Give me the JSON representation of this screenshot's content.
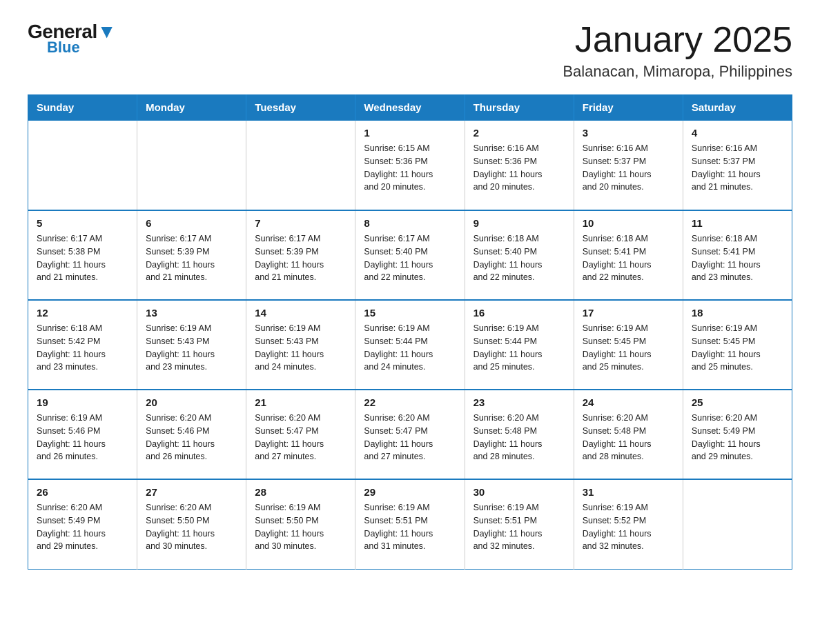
{
  "header": {
    "logo_general": "General",
    "logo_blue": "Blue",
    "month_title": "January 2025",
    "location": "Balanacan, Mimaropa, Philippines"
  },
  "calendar": {
    "days_of_week": [
      "Sunday",
      "Monday",
      "Tuesday",
      "Wednesday",
      "Thursday",
      "Friday",
      "Saturday"
    ],
    "weeks": [
      [
        {
          "day": "",
          "info": ""
        },
        {
          "day": "",
          "info": ""
        },
        {
          "day": "",
          "info": ""
        },
        {
          "day": "1",
          "info": "Sunrise: 6:15 AM\nSunset: 5:36 PM\nDaylight: 11 hours\nand 20 minutes."
        },
        {
          "day": "2",
          "info": "Sunrise: 6:16 AM\nSunset: 5:36 PM\nDaylight: 11 hours\nand 20 minutes."
        },
        {
          "day": "3",
          "info": "Sunrise: 6:16 AM\nSunset: 5:37 PM\nDaylight: 11 hours\nand 20 minutes."
        },
        {
          "day": "4",
          "info": "Sunrise: 6:16 AM\nSunset: 5:37 PM\nDaylight: 11 hours\nand 21 minutes."
        }
      ],
      [
        {
          "day": "5",
          "info": "Sunrise: 6:17 AM\nSunset: 5:38 PM\nDaylight: 11 hours\nand 21 minutes."
        },
        {
          "day": "6",
          "info": "Sunrise: 6:17 AM\nSunset: 5:39 PM\nDaylight: 11 hours\nand 21 minutes."
        },
        {
          "day": "7",
          "info": "Sunrise: 6:17 AM\nSunset: 5:39 PM\nDaylight: 11 hours\nand 21 minutes."
        },
        {
          "day": "8",
          "info": "Sunrise: 6:17 AM\nSunset: 5:40 PM\nDaylight: 11 hours\nand 22 minutes."
        },
        {
          "day": "9",
          "info": "Sunrise: 6:18 AM\nSunset: 5:40 PM\nDaylight: 11 hours\nand 22 minutes."
        },
        {
          "day": "10",
          "info": "Sunrise: 6:18 AM\nSunset: 5:41 PM\nDaylight: 11 hours\nand 22 minutes."
        },
        {
          "day": "11",
          "info": "Sunrise: 6:18 AM\nSunset: 5:41 PM\nDaylight: 11 hours\nand 23 minutes."
        }
      ],
      [
        {
          "day": "12",
          "info": "Sunrise: 6:18 AM\nSunset: 5:42 PM\nDaylight: 11 hours\nand 23 minutes."
        },
        {
          "day": "13",
          "info": "Sunrise: 6:19 AM\nSunset: 5:43 PM\nDaylight: 11 hours\nand 23 minutes."
        },
        {
          "day": "14",
          "info": "Sunrise: 6:19 AM\nSunset: 5:43 PM\nDaylight: 11 hours\nand 24 minutes."
        },
        {
          "day": "15",
          "info": "Sunrise: 6:19 AM\nSunset: 5:44 PM\nDaylight: 11 hours\nand 24 minutes."
        },
        {
          "day": "16",
          "info": "Sunrise: 6:19 AM\nSunset: 5:44 PM\nDaylight: 11 hours\nand 25 minutes."
        },
        {
          "day": "17",
          "info": "Sunrise: 6:19 AM\nSunset: 5:45 PM\nDaylight: 11 hours\nand 25 minutes."
        },
        {
          "day": "18",
          "info": "Sunrise: 6:19 AM\nSunset: 5:45 PM\nDaylight: 11 hours\nand 25 minutes."
        }
      ],
      [
        {
          "day": "19",
          "info": "Sunrise: 6:19 AM\nSunset: 5:46 PM\nDaylight: 11 hours\nand 26 minutes."
        },
        {
          "day": "20",
          "info": "Sunrise: 6:20 AM\nSunset: 5:46 PM\nDaylight: 11 hours\nand 26 minutes."
        },
        {
          "day": "21",
          "info": "Sunrise: 6:20 AM\nSunset: 5:47 PM\nDaylight: 11 hours\nand 27 minutes."
        },
        {
          "day": "22",
          "info": "Sunrise: 6:20 AM\nSunset: 5:47 PM\nDaylight: 11 hours\nand 27 minutes."
        },
        {
          "day": "23",
          "info": "Sunrise: 6:20 AM\nSunset: 5:48 PM\nDaylight: 11 hours\nand 28 minutes."
        },
        {
          "day": "24",
          "info": "Sunrise: 6:20 AM\nSunset: 5:48 PM\nDaylight: 11 hours\nand 28 minutes."
        },
        {
          "day": "25",
          "info": "Sunrise: 6:20 AM\nSunset: 5:49 PM\nDaylight: 11 hours\nand 29 minutes."
        }
      ],
      [
        {
          "day": "26",
          "info": "Sunrise: 6:20 AM\nSunset: 5:49 PM\nDaylight: 11 hours\nand 29 minutes."
        },
        {
          "day": "27",
          "info": "Sunrise: 6:20 AM\nSunset: 5:50 PM\nDaylight: 11 hours\nand 30 minutes."
        },
        {
          "day": "28",
          "info": "Sunrise: 6:19 AM\nSunset: 5:50 PM\nDaylight: 11 hours\nand 30 minutes."
        },
        {
          "day": "29",
          "info": "Sunrise: 6:19 AM\nSunset: 5:51 PM\nDaylight: 11 hours\nand 31 minutes."
        },
        {
          "day": "30",
          "info": "Sunrise: 6:19 AM\nSunset: 5:51 PM\nDaylight: 11 hours\nand 32 minutes."
        },
        {
          "day": "31",
          "info": "Sunrise: 6:19 AM\nSunset: 5:52 PM\nDaylight: 11 hours\nand 32 minutes."
        },
        {
          "day": "",
          "info": ""
        }
      ]
    ]
  }
}
